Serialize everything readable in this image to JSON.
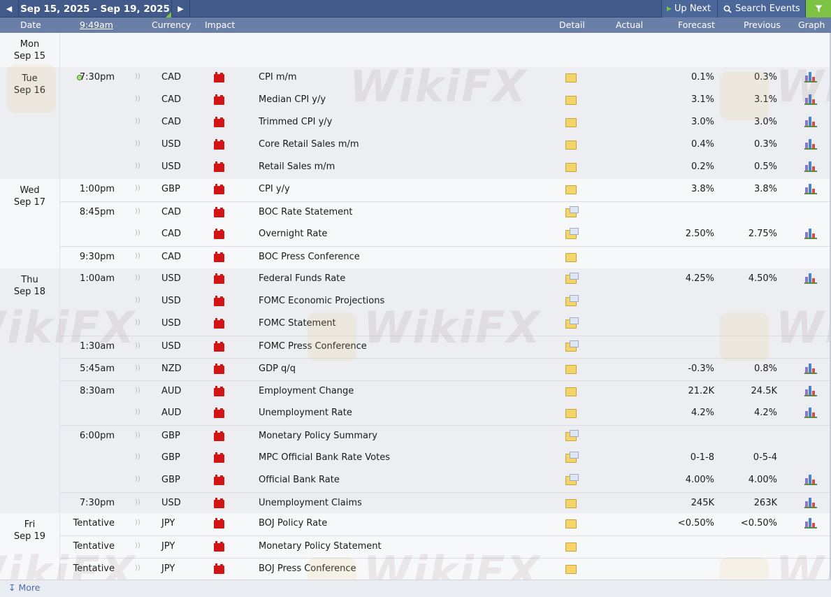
{
  "toolbar": {
    "prev_icon": "◀",
    "week_range": "Sep 15, 2025 - Sep 19, 2025",
    "next_icon": "▶",
    "up_next_label": "Up Next",
    "search_label": "Search Events",
    "filter_icon": "filter-icon"
  },
  "columns": {
    "date": "Date",
    "time": "9:49am",
    "currency": "Currency",
    "impact": "Impact",
    "detail": "Detail",
    "actual": "Actual",
    "forecast": "Forecast",
    "previous": "Previous",
    "graph": "Graph"
  },
  "days": [
    {
      "dow": "Mon",
      "date": "Sep 15"
    },
    {
      "dow": "Tue",
      "date": "Sep 16"
    },
    {
      "dow": "Wed",
      "date": "Sep 17"
    },
    {
      "dow": "Thu",
      "date": "Sep 18"
    },
    {
      "dow": "Fri",
      "date": "Sep 19"
    }
  ],
  "events": [
    {
      "time": "7:30pm",
      "currency": "CAD",
      "event": "CPI m/m",
      "forecast": "0.1%",
      "previous": "0.3%",
      "graph": true
    },
    {
      "time": "",
      "currency": "CAD",
      "event": "Median CPI y/y",
      "forecast": "3.1%",
      "previous": "3.1%",
      "graph": true
    },
    {
      "time": "",
      "currency": "CAD",
      "event": "Trimmed CPI y/y",
      "forecast": "3.0%",
      "previous": "3.0%",
      "graph": true
    },
    {
      "time": "",
      "currency": "USD",
      "event": "Core Retail Sales m/m",
      "forecast": "0.4%",
      "previous": "0.3%",
      "graph": true
    },
    {
      "time": "",
      "currency": "USD",
      "event": "Retail Sales m/m",
      "forecast": "0.2%",
      "previous": "0.5%",
      "graph": true
    },
    {
      "time": "1:00pm",
      "currency": "GBP",
      "event": "CPI y/y",
      "forecast": "3.8%",
      "previous": "3.8%",
      "graph": true
    },
    {
      "time": "8:45pm",
      "currency": "CAD",
      "event": "BOC Rate Statement",
      "forecast": "",
      "previous": "",
      "graph": false
    },
    {
      "time": "",
      "currency": "CAD",
      "event": "Overnight Rate",
      "forecast": "2.50%",
      "previous": "2.75%",
      "graph": true
    },
    {
      "time": "9:30pm",
      "currency": "CAD",
      "event": "BOC Press Conference",
      "forecast": "",
      "previous": "",
      "graph": false
    },
    {
      "time": "1:00am",
      "currency": "USD",
      "event": "Federal Funds Rate",
      "forecast": "4.25%",
      "previous": "4.50%",
      "graph": true
    },
    {
      "time": "",
      "currency": "USD",
      "event": "FOMC Economic Projections",
      "forecast": "",
      "previous": "",
      "graph": false
    },
    {
      "time": "",
      "currency": "USD",
      "event": "FOMC Statement",
      "forecast": "",
      "previous": "",
      "graph": false
    },
    {
      "time": "1:30am",
      "currency": "USD",
      "event": "FOMC Press Conference",
      "forecast": "",
      "previous": "",
      "graph": false
    },
    {
      "time": "5:45am",
      "currency": "NZD",
      "event": "GDP q/q",
      "forecast": "-0.3%",
      "previous": "0.8%",
      "graph": true
    },
    {
      "time": "8:30am",
      "currency": "AUD",
      "event": "Employment Change",
      "forecast": "21.2K",
      "previous": "24.5K",
      "graph": true
    },
    {
      "time": "",
      "currency": "AUD",
      "event": "Unemployment Rate",
      "forecast": "4.2%",
      "previous": "4.2%",
      "graph": true
    },
    {
      "time": "6:00pm",
      "currency": "GBP",
      "event": "Monetary Policy Summary",
      "forecast": "",
      "previous": "",
      "graph": false
    },
    {
      "time": "",
      "currency": "GBP",
      "event": "MPC Official Bank Rate Votes",
      "forecast": "0-1-8",
      "previous": "0-5-4",
      "graph": false
    },
    {
      "time": "",
      "currency": "GBP",
      "event": "Official Bank Rate",
      "forecast": "4.00%",
      "previous": "4.00%",
      "graph": true
    },
    {
      "time": "7:30pm",
      "currency": "USD",
      "event": "Unemployment Claims",
      "forecast": "245K",
      "previous": "263K",
      "graph": true
    },
    {
      "time": "Tentative",
      "currency": "JPY",
      "event": "BOJ Policy Rate",
      "forecast": "<0.50%",
      "previous": "<0.50%",
      "graph": true
    },
    {
      "time": "Tentative",
      "currency": "JPY",
      "event": "Monetary Policy Statement",
      "forecast": "",
      "previous": "",
      "graph": false
    },
    {
      "time": "Tentative",
      "currency": "JPY",
      "event": "BOJ Press Conference",
      "forecast": "",
      "previous": "",
      "graph": false
    }
  ],
  "watermark": "WikiFX",
  "footer": {
    "more_label": "More",
    "more_icon": "↧"
  },
  "colors": {
    "toolbar_bg": "#415a8a",
    "header_bg": "#6a7fa7",
    "accent_green": "#7dc242",
    "impact_red": "#d31414",
    "shaded_row": "#eceef2"
  }
}
